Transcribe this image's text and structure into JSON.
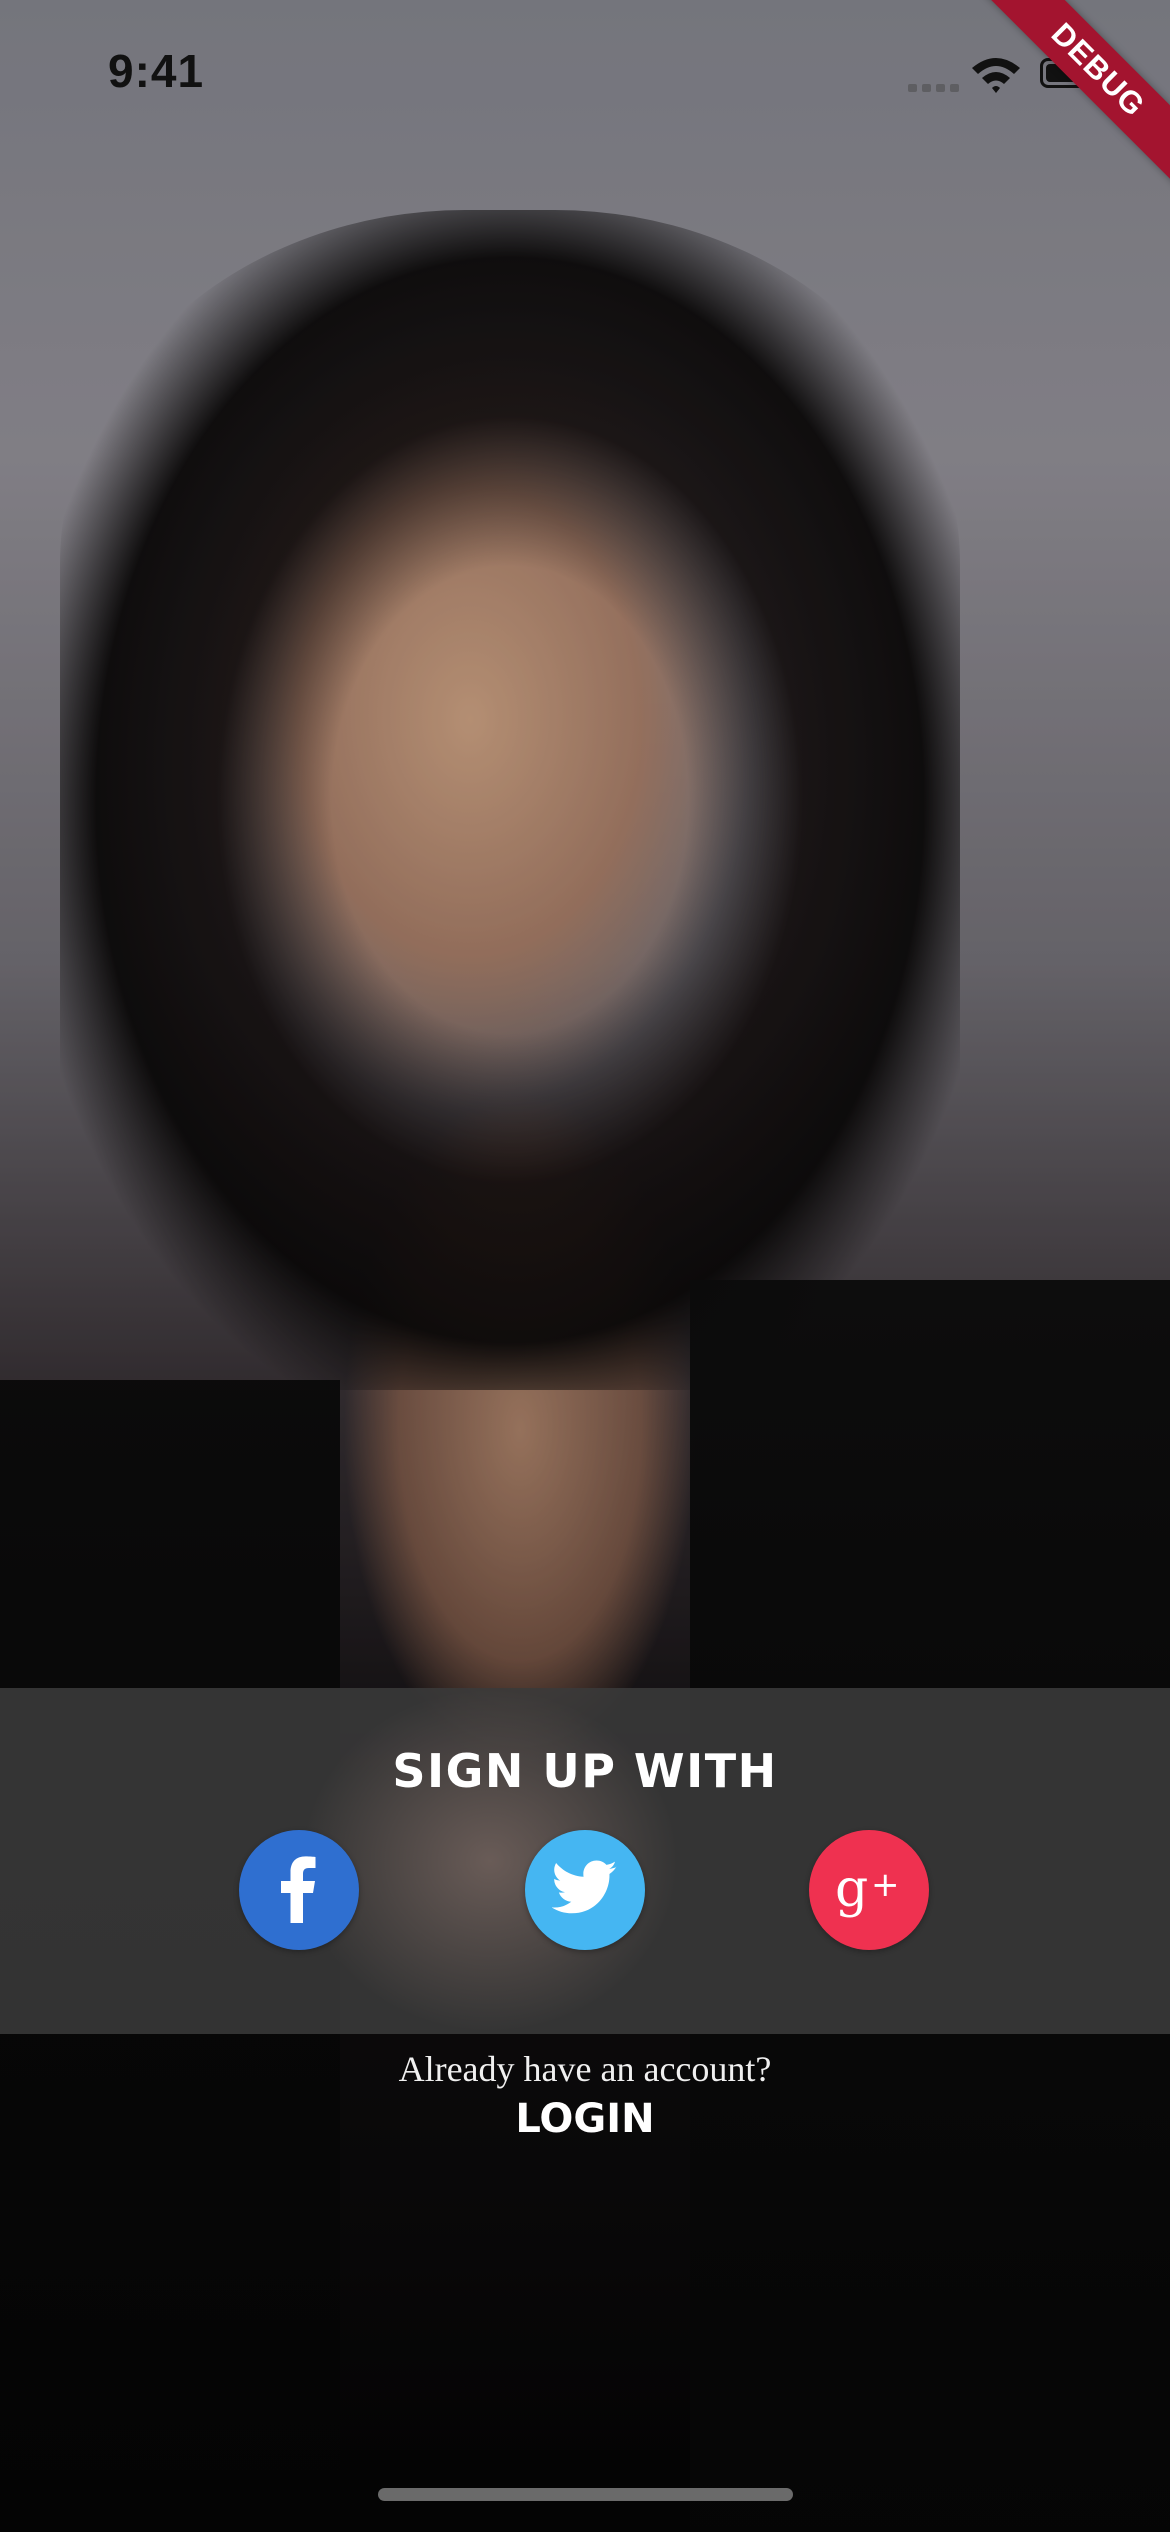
{
  "status_bar": {
    "time": "9:41"
  },
  "debug_banner": {
    "label": "DEBUG",
    "color": "#a3142f"
  },
  "signup": {
    "title": "SIGN UP WITH",
    "buttons": [
      {
        "name": "facebook",
        "icon": "facebook-icon",
        "color": "#2f6fd0"
      },
      {
        "name": "twitter",
        "icon": "twitter-icon",
        "color": "#45b6f2"
      },
      {
        "name": "google_plus",
        "icon": "google-plus-icon",
        "color": "#ef3150"
      }
    ]
  },
  "login": {
    "prompt": "Already have an account?",
    "link_label": "LOGIN"
  },
  "background": {
    "panel_color": "#3a3a3a"
  }
}
